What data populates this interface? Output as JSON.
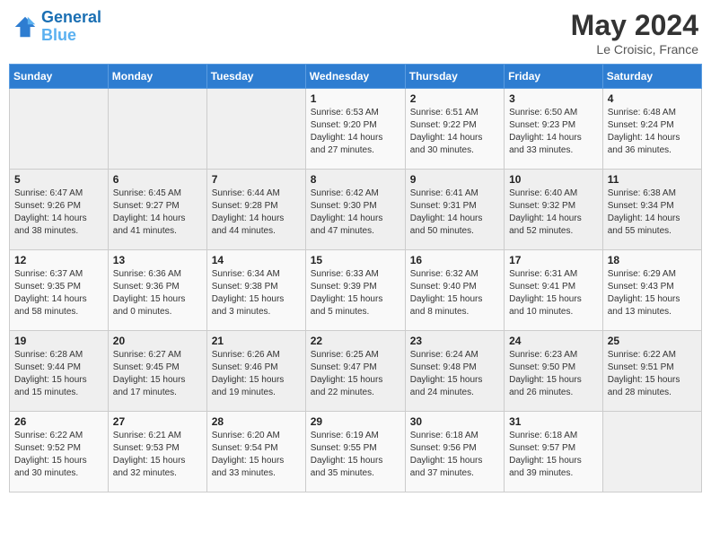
{
  "header": {
    "logo_line1": "General",
    "logo_line2": "Blue",
    "month": "May 2024",
    "location": "Le Croisic, France"
  },
  "days_of_week": [
    "Sunday",
    "Monday",
    "Tuesday",
    "Wednesday",
    "Thursday",
    "Friday",
    "Saturday"
  ],
  "weeks": [
    [
      {
        "day": "",
        "info": ""
      },
      {
        "day": "",
        "info": ""
      },
      {
        "day": "",
        "info": ""
      },
      {
        "day": "1",
        "info": "Sunrise: 6:53 AM\nSunset: 9:20 PM\nDaylight: 14 hours and 27 minutes."
      },
      {
        "day": "2",
        "info": "Sunrise: 6:51 AM\nSunset: 9:22 PM\nDaylight: 14 hours and 30 minutes."
      },
      {
        "day": "3",
        "info": "Sunrise: 6:50 AM\nSunset: 9:23 PM\nDaylight: 14 hours and 33 minutes."
      },
      {
        "day": "4",
        "info": "Sunrise: 6:48 AM\nSunset: 9:24 PM\nDaylight: 14 hours and 36 minutes."
      }
    ],
    [
      {
        "day": "5",
        "info": "Sunrise: 6:47 AM\nSunset: 9:26 PM\nDaylight: 14 hours and 38 minutes."
      },
      {
        "day": "6",
        "info": "Sunrise: 6:45 AM\nSunset: 9:27 PM\nDaylight: 14 hours and 41 minutes."
      },
      {
        "day": "7",
        "info": "Sunrise: 6:44 AM\nSunset: 9:28 PM\nDaylight: 14 hours and 44 minutes."
      },
      {
        "day": "8",
        "info": "Sunrise: 6:42 AM\nSunset: 9:30 PM\nDaylight: 14 hours and 47 minutes."
      },
      {
        "day": "9",
        "info": "Sunrise: 6:41 AM\nSunset: 9:31 PM\nDaylight: 14 hours and 50 minutes."
      },
      {
        "day": "10",
        "info": "Sunrise: 6:40 AM\nSunset: 9:32 PM\nDaylight: 14 hours and 52 minutes."
      },
      {
        "day": "11",
        "info": "Sunrise: 6:38 AM\nSunset: 9:34 PM\nDaylight: 14 hours and 55 minutes."
      }
    ],
    [
      {
        "day": "12",
        "info": "Sunrise: 6:37 AM\nSunset: 9:35 PM\nDaylight: 14 hours and 58 minutes."
      },
      {
        "day": "13",
        "info": "Sunrise: 6:36 AM\nSunset: 9:36 PM\nDaylight: 15 hours and 0 minutes."
      },
      {
        "day": "14",
        "info": "Sunrise: 6:34 AM\nSunset: 9:38 PM\nDaylight: 15 hours and 3 minutes."
      },
      {
        "day": "15",
        "info": "Sunrise: 6:33 AM\nSunset: 9:39 PM\nDaylight: 15 hours and 5 minutes."
      },
      {
        "day": "16",
        "info": "Sunrise: 6:32 AM\nSunset: 9:40 PM\nDaylight: 15 hours and 8 minutes."
      },
      {
        "day": "17",
        "info": "Sunrise: 6:31 AM\nSunset: 9:41 PM\nDaylight: 15 hours and 10 minutes."
      },
      {
        "day": "18",
        "info": "Sunrise: 6:29 AM\nSunset: 9:43 PM\nDaylight: 15 hours and 13 minutes."
      }
    ],
    [
      {
        "day": "19",
        "info": "Sunrise: 6:28 AM\nSunset: 9:44 PM\nDaylight: 15 hours and 15 minutes."
      },
      {
        "day": "20",
        "info": "Sunrise: 6:27 AM\nSunset: 9:45 PM\nDaylight: 15 hours and 17 minutes."
      },
      {
        "day": "21",
        "info": "Sunrise: 6:26 AM\nSunset: 9:46 PM\nDaylight: 15 hours and 19 minutes."
      },
      {
        "day": "22",
        "info": "Sunrise: 6:25 AM\nSunset: 9:47 PM\nDaylight: 15 hours and 22 minutes."
      },
      {
        "day": "23",
        "info": "Sunrise: 6:24 AM\nSunset: 9:48 PM\nDaylight: 15 hours and 24 minutes."
      },
      {
        "day": "24",
        "info": "Sunrise: 6:23 AM\nSunset: 9:50 PM\nDaylight: 15 hours and 26 minutes."
      },
      {
        "day": "25",
        "info": "Sunrise: 6:22 AM\nSunset: 9:51 PM\nDaylight: 15 hours and 28 minutes."
      }
    ],
    [
      {
        "day": "26",
        "info": "Sunrise: 6:22 AM\nSunset: 9:52 PM\nDaylight: 15 hours and 30 minutes."
      },
      {
        "day": "27",
        "info": "Sunrise: 6:21 AM\nSunset: 9:53 PM\nDaylight: 15 hours and 32 minutes."
      },
      {
        "day": "28",
        "info": "Sunrise: 6:20 AM\nSunset: 9:54 PM\nDaylight: 15 hours and 33 minutes."
      },
      {
        "day": "29",
        "info": "Sunrise: 6:19 AM\nSunset: 9:55 PM\nDaylight: 15 hours and 35 minutes."
      },
      {
        "day": "30",
        "info": "Sunrise: 6:18 AM\nSunset: 9:56 PM\nDaylight: 15 hours and 37 minutes."
      },
      {
        "day": "31",
        "info": "Sunrise: 6:18 AM\nSunset: 9:57 PM\nDaylight: 15 hours and 39 minutes."
      },
      {
        "day": "",
        "info": ""
      }
    ]
  ]
}
